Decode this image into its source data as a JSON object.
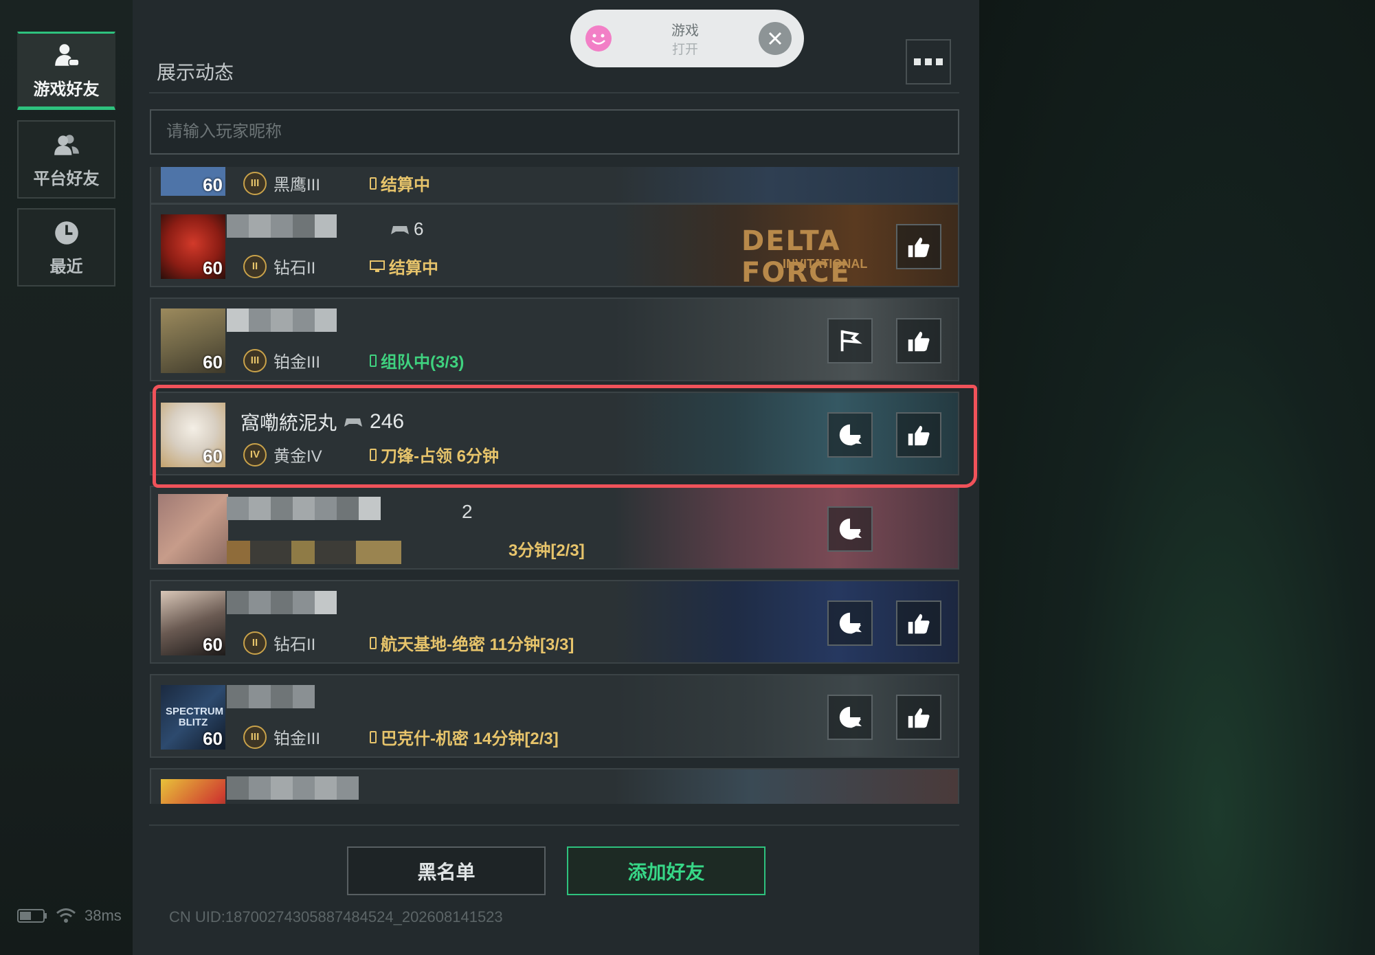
{
  "sidebar": {
    "tabs": [
      {
        "label": "游戏好友",
        "icon": "game-friends-icon",
        "active": true
      },
      {
        "label": "平台好友",
        "icon": "platform-friends-icon",
        "active": false
      },
      {
        "label": "最近",
        "icon": "clock-icon",
        "active": false
      }
    ]
  },
  "status_bar": {
    "ping": "38ms"
  },
  "header": {
    "title": "展示动态"
  },
  "search": {
    "placeholder": "请输入玩家昵称"
  },
  "toast": {
    "title": "游戏",
    "subtitle": "打开"
  },
  "friends": [
    {
      "name": "",
      "count": "",
      "level": "60",
      "rank": "黑鹰III",
      "rank_tier": "III",
      "status": "结算中",
      "status_color": "yellow"
    },
    {
      "name": "",
      "count": "6",
      "level": "60",
      "rank": "钻石II",
      "rank_tier": "II",
      "status": "结算中",
      "status_color": "yellow",
      "scene_text": "DELTA FORCE",
      "scene_sub": "INVITATIONAL"
    },
    {
      "name": "",
      "count": "",
      "level": "60",
      "rank": "铂金III",
      "rank_tier": "III",
      "status": "组队中(3/3)",
      "status_color": "green"
    },
    {
      "name": "窩嘞統泥丸",
      "count": "246",
      "level": "60",
      "rank": "黄金IV",
      "rank_tier": "IV",
      "status": "刀锋-占领 6分钟",
      "status_color": "yellow"
    },
    {
      "name": "",
      "count": "2",
      "level": "",
      "rank": "",
      "rank_tier": "",
      "status": "3分钟[2/3]",
      "status_color": "yellow"
    },
    {
      "name": "",
      "count": "",
      "level": "60",
      "rank": "钻石II",
      "rank_tier": "II",
      "status": "航天基地-绝密 11分钟[3/3]",
      "status_color": "yellow"
    },
    {
      "name": "",
      "count": "",
      "level": "60",
      "rank": "铂金III",
      "rank_tier": "III",
      "status": "巴克什-机密 14分钟[2/3]",
      "status_color": "yellow",
      "avatar_text": "SPECTRUM BLITZ"
    },
    {
      "name": "",
      "count": "",
      "level": "",
      "rank": "",
      "rank_tier": "",
      "status": "",
      "status_color": "yellow"
    }
  ],
  "footer": {
    "blacklist_label": "黑名单",
    "add_friend_label": "添加好友",
    "uid": "CN UID:18700274305887484524_202608141523"
  },
  "colors": {
    "accent": "#2ec27e",
    "highlight": "#f0525a",
    "status_yellow": "#e7c46b",
    "status_green": "#3fd27f"
  }
}
